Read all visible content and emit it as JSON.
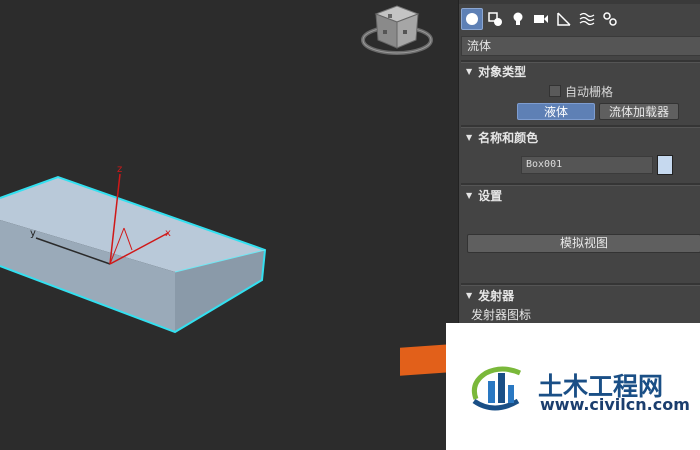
{
  "viewport": {
    "axis_labels": {
      "x": "x",
      "y": "y",
      "z": "z"
    },
    "selection_color": "#33e0f0",
    "box_color": "#b5c6d6"
  },
  "panel": {
    "tabs": [
      {
        "name": "create-geometry-icon",
        "active": true
      },
      {
        "name": "create-shapes-icon",
        "active": false
      },
      {
        "name": "create-lights-icon",
        "active": false
      },
      {
        "name": "create-cameras-icon",
        "active": false
      },
      {
        "name": "create-helpers-icon",
        "active": false
      },
      {
        "name": "create-spacewarps-icon",
        "active": false
      },
      {
        "name": "create-systems-icon",
        "active": false
      }
    ],
    "category": "流体",
    "object_type": {
      "title": "对象类型",
      "autogrid_label": "自动栅格",
      "buttons": [
        "液体",
        "流体加载器"
      ],
      "selected": "液体"
    },
    "name_and_color": {
      "title": "名称和颜色",
      "name_value": "Box001",
      "color": "#c6d9ef"
    },
    "settings": {
      "title": "设置",
      "sim_view_button": "模拟视图"
    },
    "emitter": {
      "title": "发射器",
      "icon_label": "发射器图标"
    }
  },
  "watermark": {
    "title": "土木工程网",
    "url": "www.civilcn.com"
  }
}
